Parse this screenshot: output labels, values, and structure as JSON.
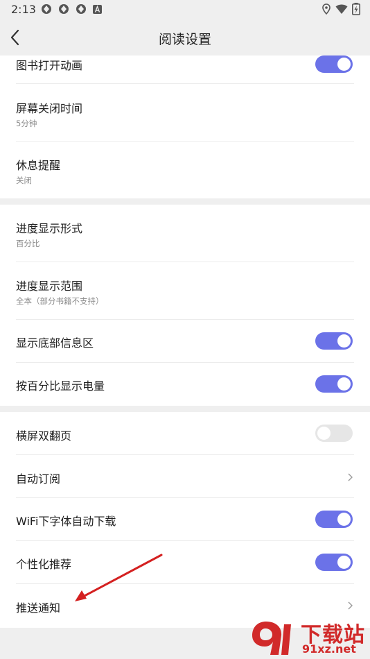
{
  "status_bar": {
    "time": "2:13"
  },
  "header": {
    "title": "阅读设置"
  },
  "settings": {
    "book_open_animation": {
      "label": "图书打开动画",
      "enabled": true
    },
    "screen_off_time": {
      "label": "屏幕关闭时间",
      "value": "5分钟"
    },
    "rest_reminder": {
      "label": "休息提醒",
      "value": "关闭"
    },
    "progress_display_format": {
      "label": "进度显示形式",
      "value": "百分比"
    },
    "progress_display_range": {
      "label": "进度显示范围",
      "value": "全本（部分书籍不支持）"
    },
    "show_bottom_info": {
      "label": "显示底部信息区",
      "enabled": true
    },
    "battery_percent": {
      "label": "按百分比显示电量",
      "enabled": true
    },
    "landscape_double_page": {
      "label": "横屏双翻页",
      "enabled": false
    },
    "auto_subscribe": {
      "label": "自动订阅"
    },
    "wifi_font_download": {
      "label": "WiFi下字体自动下载",
      "enabled": true
    },
    "personalized_recommend": {
      "label": "个性化推荐",
      "enabled": true
    },
    "push_notification": {
      "label": "推送通知"
    }
  },
  "watermark": {
    "text": "下载站",
    "url": "91xz.net"
  },
  "colors": {
    "accent": "#6b72e8",
    "toggle_off": "#e6e6e6",
    "annotation_arrow": "#d42020",
    "watermark": "#d12a2a"
  }
}
